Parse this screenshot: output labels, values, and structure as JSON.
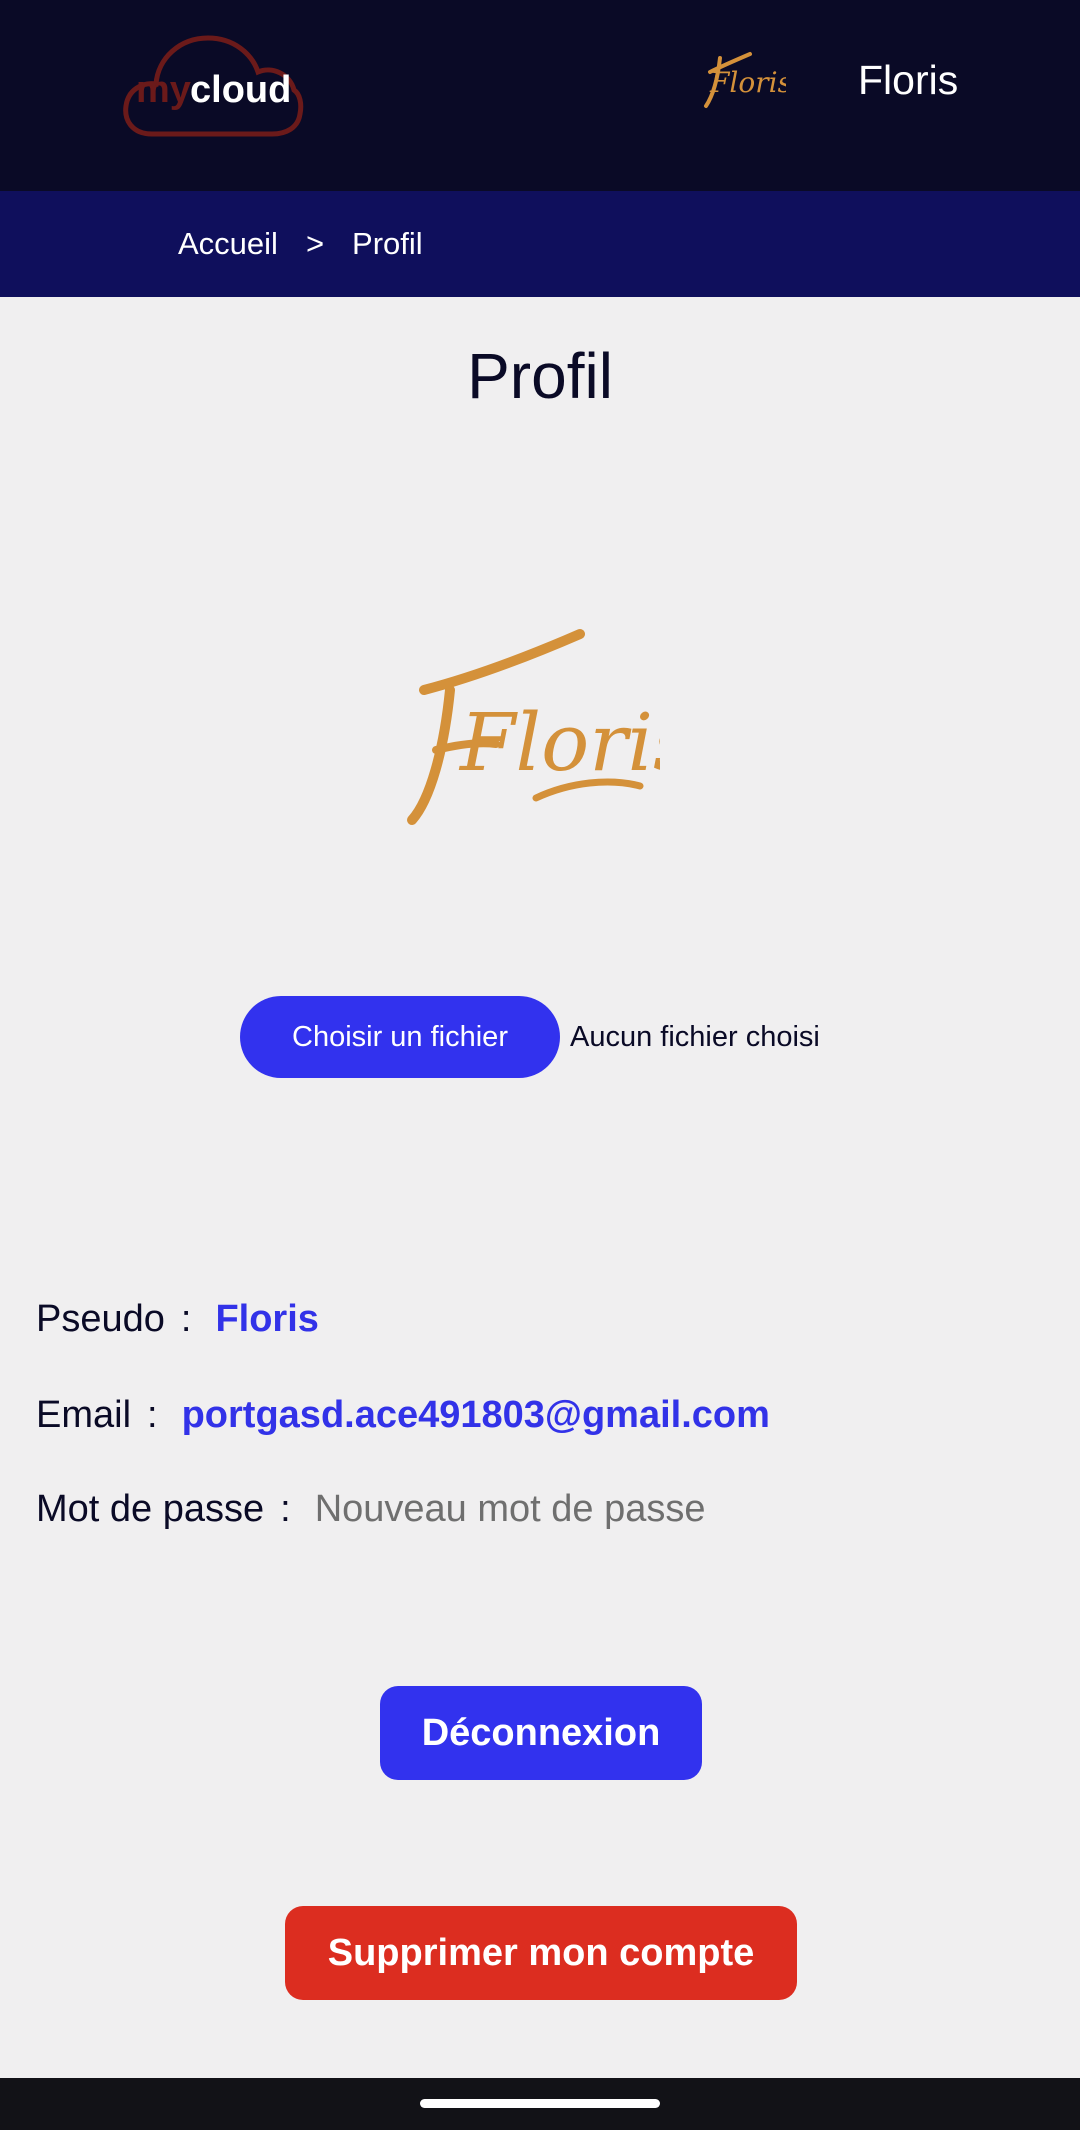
{
  "header": {
    "logo_text_my": "my",
    "logo_text_cloud": "cloud",
    "user_name": "Floris",
    "avatar_text": "Floris"
  },
  "breadcrumb": {
    "home": "Accueil",
    "separator": ">",
    "current": "Profil"
  },
  "page": {
    "title": "Profil",
    "avatar_text": "Floris"
  },
  "file_input": {
    "button_label": "Choisir un fichier",
    "status": "Aucun fichier choisi"
  },
  "profile": {
    "pseudo_label": "Pseudo",
    "pseudo_value": "Floris",
    "email_label": "Email",
    "email_value": "portgasd.ace491803@gmail.com",
    "password_label": "Mot de passe",
    "password_placeholder": "Nouveau mot de passe",
    "colon": ":"
  },
  "actions": {
    "logout_label": "Déconnexion",
    "delete_label": "Supprimer mon compte"
  },
  "colors": {
    "header_bg": "#0a0a26",
    "breadcrumb_bg": "#0f0f5c",
    "accent": "#3232ee",
    "danger": "#dc2d20",
    "avatar_gold": "#d4913a",
    "logo_red": "#6b1a1a"
  }
}
